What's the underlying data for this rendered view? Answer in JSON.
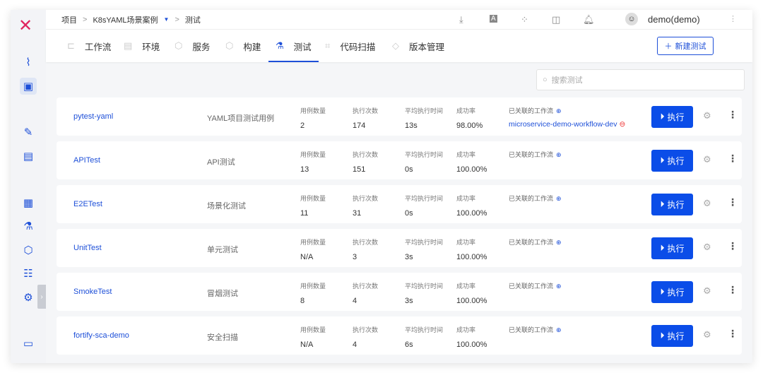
{
  "breadcrumb": {
    "root": "项目",
    "project": "K8sYAML场景案例",
    "current": "测试"
  },
  "user": {
    "name": "demo(demo)"
  },
  "tabs": [
    {
      "label": "工作流",
      "icon": "workflow-icon"
    },
    {
      "label": "环境",
      "icon": "environment-icon"
    },
    {
      "label": "服务",
      "icon": "service-icon"
    },
    {
      "label": "构建",
      "icon": "build-icon"
    },
    {
      "label": "测试",
      "icon": "flask-icon"
    },
    {
      "label": "代码扫描",
      "icon": "scan-icon"
    },
    {
      "label": "版本管理",
      "icon": "version-icon"
    }
  ],
  "new_button": "新建测试",
  "search": {
    "placeholder": "搜索测试"
  },
  "labels": {
    "cases": "用例数量",
    "runs": "执行次数",
    "avg": "平均执行时间",
    "rate": "成功率",
    "workflows": "已关联的工作流",
    "run": "执行"
  },
  "tests": [
    {
      "name": "pytest-yaml",
      "desc": "YAML项目测试用例",
      "cases": "2",
      "runs": "174",
      "avg": "13s",
      "rate": "98.00%",
      "workflow": "microservice-demo-workflow-dev"
    },
    {
      "name": "APITest",
      "desc": "API测试",
      "cases": "13",
      "runs": "151",
      "avg": "0s",
      "rate": "100.00%"
    },
    {
      "name": "E2ETest",
      "desc": "场景化测试",
      "cases": "11",
      "runs": "31",
      "avg": "0s",
      "rate": "100.00%"
    },
    {
      "name": "UnitTest",
      "desc": "单元测试",
      "cases": "N/A",
      "runs": "3",
      "avg": "3s",
      "rate": "100.00%"
    },
    {
      "name": "SmokeTest",
      "desc": "冒烟测试",
      "cases": "8",
      "runs": "4",
      "avg": "3s",
      "rate": "100.00%"
    },
    {
      "name": "fortify-sca-demo",
      "desc": "安全扫描",
      "cases": "N/A",
      "runs": "4",
      "avg": "6s",
      "rate": "100.00%"
    }
  ]
}
